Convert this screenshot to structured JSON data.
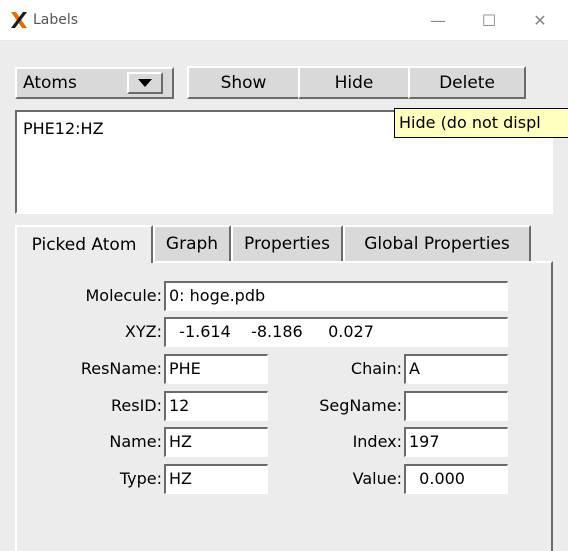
{
  "window": {
    "title": "Labels",
    "minimize_glyph": "—",
    "maximize_glyph": "☐",
    "close_glyph": "✕"
  },
  "toolbar": {
    "category_selected": "Atoms",
    "show_label": "Show",
    "hide_label": "Hide",
    "delete_label": "Delete"
  },
  "tooltip": "Hide (do not displ",
  "labels_list": [
    "PHE12:HZ"
  ],
  "tabs": [
    "Picked Atom",
    "Graph",
    "Properties",
    "Global Properties"
  ],
  "picked_atom": {
    "molecule_label": "Molecule:",
    "molecule_value": "0: hoge.pdb",
    "xyz_label": "XYZ:",
    "xyz_value": "  -1.614    -8.186     0.027",
    "resname_label": "ResName:",
    "resname_value": "PHE",
    "chain_label": "Chain:",
    "chain_value": "A",
    "resid_label": "ResID:",
    "resid_value": "12",
    "segname_label": "SegName:",
    "segname_value": "",
    "name_label": "Name:",
    "name_value": "HZ",
    "index_label": "Index:",
    "index_value": "197",
    "type_label": "Type:",
    "type_value": "HZ",
    "value_label": "Value:",
    "value_value": "  0.000"
  }
}
